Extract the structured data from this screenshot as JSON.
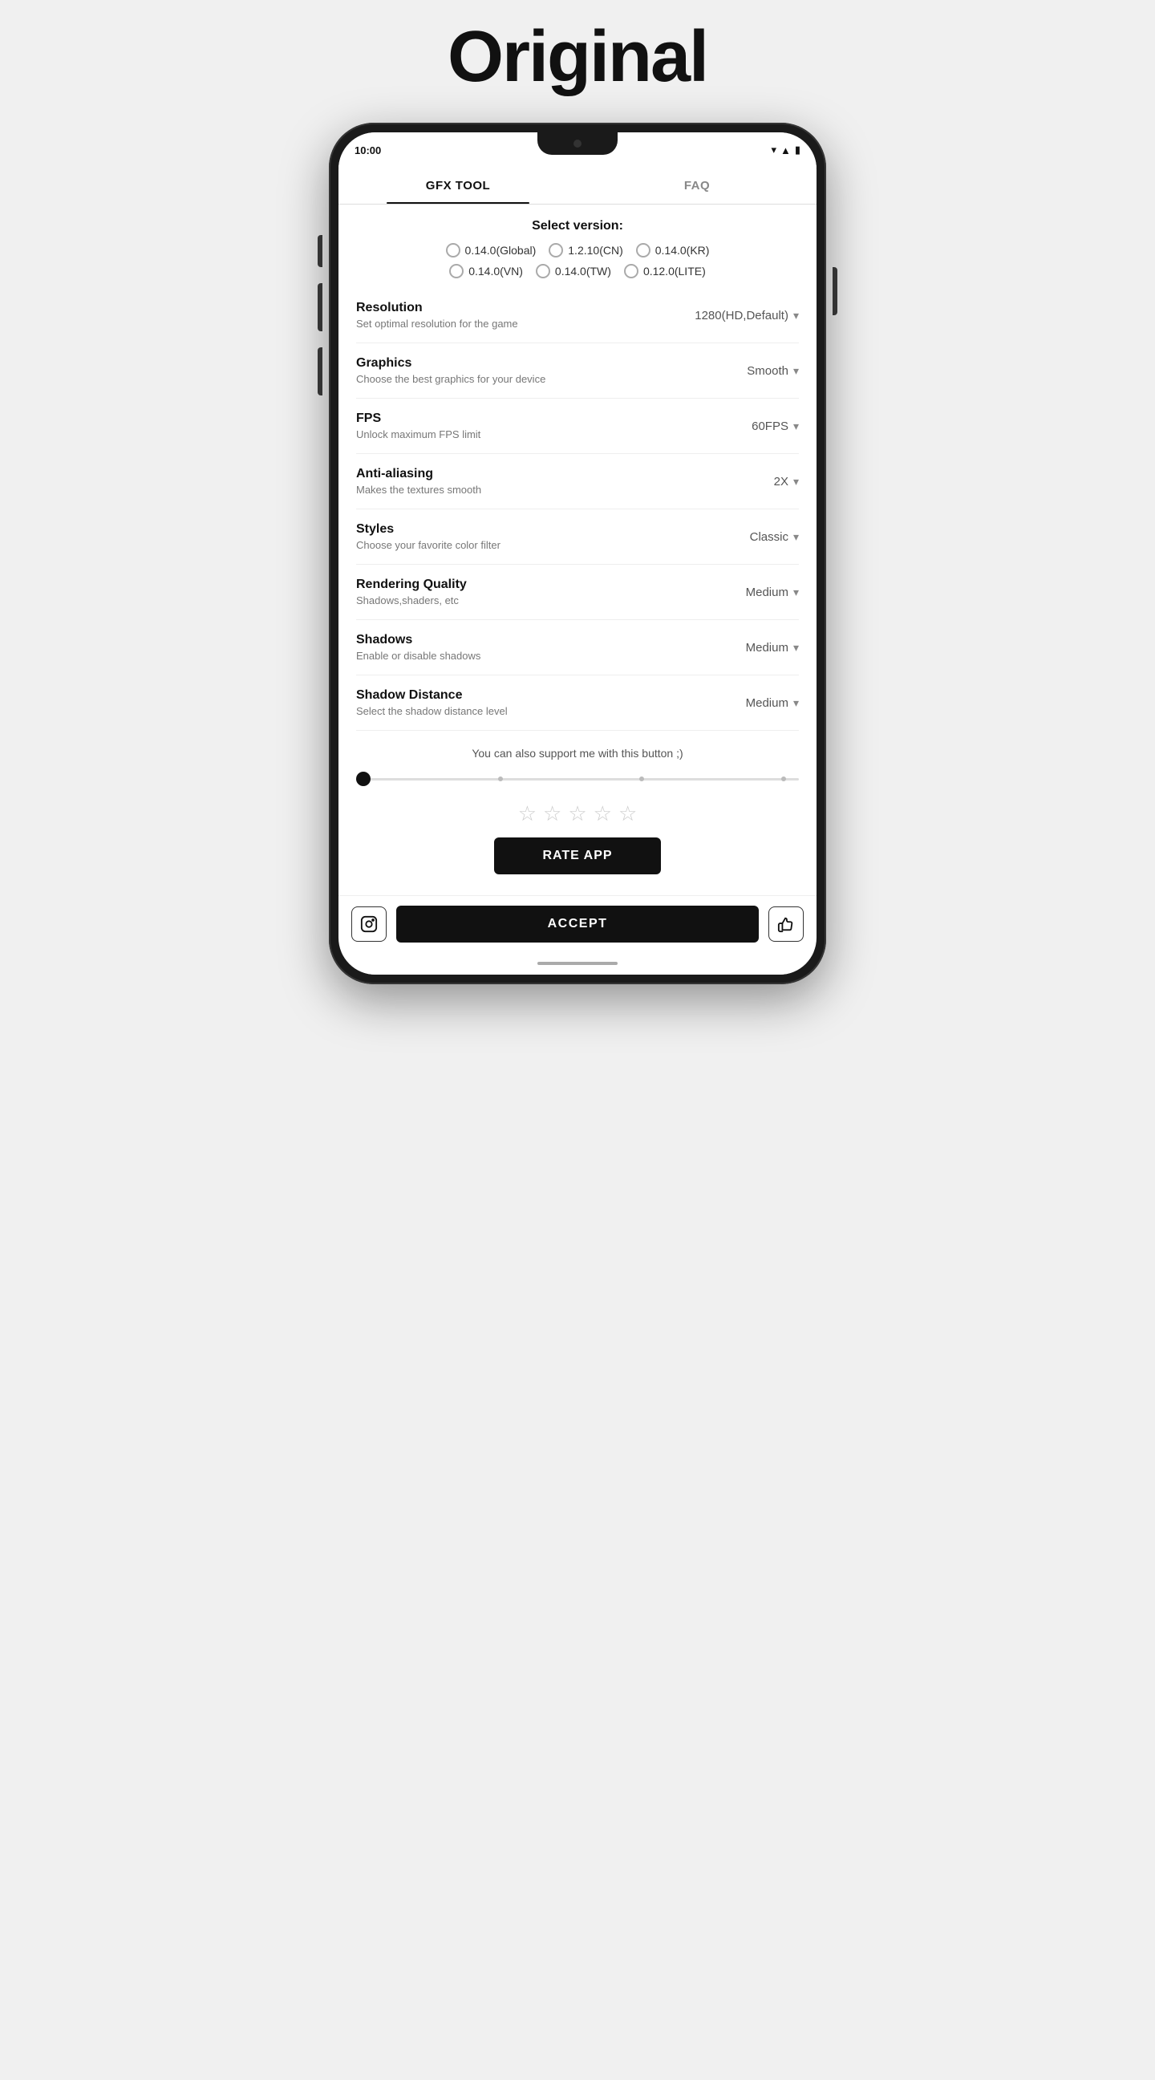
{
  "page": {
    "title": "Original"
  },
  "status_bar": {
    "time": "10:00"
  },
  "tabs": [
    {
      "label": "GFX TOOL",
      "active": true
    },
    {
      "label": "FAQ",
      "active": false
    }
  ],
  "select_version": {
    "label": "Select version:",
    "options": [
      {
        "value": "0.14.0(Global)"
      },
      {
        "value": "1.2.10(CN)"
      },
      {
        "value": "0.14.0(KR)"
      },
      {
        "value": "0.14.0(VN)"
      },
      {
        "value": "0.14.0(TW)"
      },
      {
        "value": "0.12.0(LITE)"
      }
    ]
  },
  "settings": [
    {
      "title": "Resolution",
      "desc": "Set optimal resolution for the game",
      "value": "1280(HD,Default)"
    },
    {
      "title": "Graphics",
      "desc": "Choose the best graphics for your device",
      "value": "Smooth"
    },
    {
      "title": "FPS",
      "desc": "Unlock maximum FPS limit",
      "value": "60FPS"
    },
    {
      "title": "Anti-aliasing",
      "desc": "Makes the textures smooth",
      "value": "2X"
    },
    {
      "title": "Styles",
      "desc": "Choose your favorite color filter",
      "value": "Classic"
    },
    {
      "title": "Rendering Quality",
      "desc": "Shadows,shaders, etc",
      "value": "Medium"
    },
    {
      "title": "Shadows",
      "desc": "Enable or disable shadows",
      "value": "Medium"
    },
    {
      "title": "Shadow Distance",
      "desc": "Select the shadow distance level",
      "value": "Medium"
    }
  ],
  "support": {
    "text": "You can also support me with this button ;)"
  },
  "rate_app": {
    "label": "RATE APP"
  },
  "bottom_bar": {
    "accept_label": "ACCEPT"
  }
}
